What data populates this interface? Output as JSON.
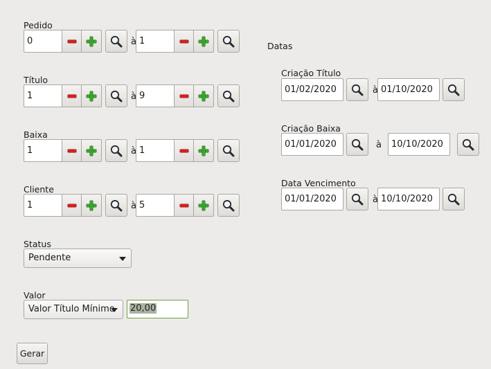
{
  "left": {
    "pedido": {
      "label": "Pedido",
      "from": "0",
      "sep": "à",
      "to": "1"
    },
    "titulo": {
      "label": "Título",
      "from": "1",
      "sep": "à",
      "to": "9"
    },
    "baixa": {
      "label": "Baixa",
      "from": "1",
      "sep": "à",
      "to": "1"
    },
    "cliente": {
      "label": "Cliente",
      "from": "1",
      "sep": "à",
      "to": "5"
    }
  },
  "status": {
    "label": "Status",
    "selected": "Pendente"
  },
  "valor": {
    "label": "Valor",
    "selected": "Valor Título Mínimo",
    "amount": "20,00"
  },
  "gerar_label": "Gerar",
  "datas": {
    "heading": "Datas",
    "criacao_titulo": {
      "label": "Criação Título",
      "from": "01/02/2020",
      "sep": "à",
      "to": "01/10/2020"
    },
    "criacao_baixa": {
      "label": "Criação Baixa",
      "from": "01/01/2020",
      "sep": "à",
      "to": "10/10/2020"
    },
    "data_vencimento": {
      "label": "Data Vencimento",
      "from": "01/01/2020",
      "sep": "à",
      "to": "10/10/2020"
    }
  },
  "icons": {
    "search": "magnifier-icon",
    "decrement": "minus-icon",
    "increment": "plus-icon",
    "dropdown": "caret-down-icon"
  },
  "colors": {
    "minus": "#d42020",
    "plus": "#3aa52e",
    "valor_focus_border": "#6aa040",
    "selection_bg": "#a9b3a0"
  }
}
